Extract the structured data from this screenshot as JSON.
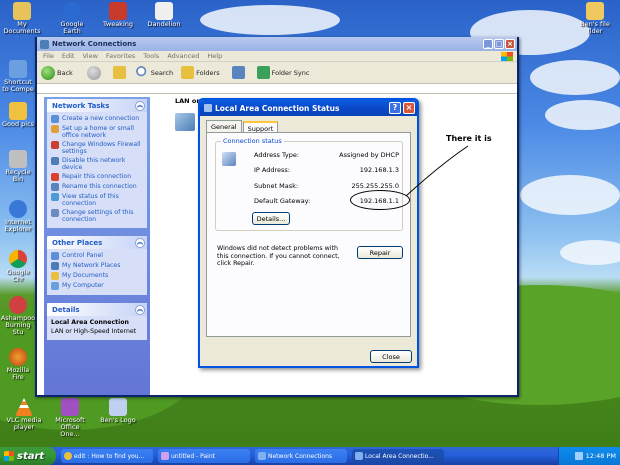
{
  "desktop": {
    "icons": [
      {
        "label": "My Documents",
        "color": "#e8c25a"
      },
      {
        "label": "Google Earth",
        "color": "#2b6ad1"
      },
      {
        "label": "Tweaking",
        "color": "#c83a2a"
      },
      {
        "label": "Dandelion",
        "color": "#f0f0f0"
      },
      {
        "label": "Shortcut to Compe",
        "color": "#6aa0e0"
      },
      {
        "label": "Good pics",
        "color": "#f0c040"
      },
      {
        "label": "Recycle Bin",
        "color": "#bfbfbf"
      },
      {
        "label": "Internet Explorer",
        "color": "#3a78d8"
      },
      {
        "label": "Google Chr",
        "color": "#e0c030"
      },
      {
        "label": "Ashampoo Burning Stu",
        "color": "#d04040"
      },
      {
        "label": "Mozilla Fire",
        "color": "#e07020"
      },
      {
        "label": "VLC media player",
        "color": "#f08020"
      },
      {
        "label": "Microsoft Office One...",
        "color": "#a050c0"
      },
      {
        "label": "Ben's Logo",
        "color": "#c0d0f0"
      },
      {
        "label": "Ben's file flder",
        "color": "#f0c860"
      }
    ]
  },
  "explorer": {
    "title": "Network Connections",
    "menu": [
      "File",
      "Edit",
      "View",
      "Favorites",
      "Tools",
      "Advanced",
      "Help"
    ],
    "toolbar": {
      "back": "Back",
      "search": "Search",
      "folders": "Folders",
      "folder_sync": "Folder Sync"
    },
    "content_header": "LAN or High-Speed Internet",
    "network_tasks": {
      "title": "Network Tasks",
      "items": [
        "Create a new connection",
        "Set up a home or small office network",
        "Change Windows Firewall settings",
        "Disable this network device",
        "Repair this connection",
        "Rename this connection",
        "View status of this connection",
        "Change settings of this connection"
      ]
    },
    "other_places": {
      "title": "Other Places",
      "items": [
        "Control Panel",
        "My Network Places",
        "My Documents",
        "My Computer"
      ]
    },
    "details": {
      "title": "Details",
      "name": "Local Area Connection",
      "type": "LAN or High-Speed Internet"
    }
  },
  "dialog": {
    "title": "Local Area Connection Status",
    "tabs": [
      "General",
      "Support"
    ],
    "active_tab": "Support",
    "group_label": "Connection status",
    "rows": [
      {
        "label": "Address Type:",
        "value": "Assigned by DHCP"
      },
      {
        "label": "IP Address:",
        "value": "192.168.1.3"
      },
      {
        "label": "Subnet Mask:",
        "value": "255.255.255.0"
      },
      {
        "label": "Default Gateway:",
        "value": "192.168.1.1"
      }
    ],
    "details_button": "Details...",
    "repair_note": "Windows did not detect problems with this connection. If you cannot connect, click Repair.",
    "repair_button": "Repair",
    "close_button": "Close"
  },
  "annotation": {
    "text": "There it is"
  },
  "taskbar": {
    "start": "start",
    "tasks": [
      {
        "label": "edit : How to find you...",
        "color": "#e8c040"
      },
      {
        "label": "untitled - Paint",
        "color": "#d0a0f0"
      },
      {
        "label": "Network Connections",
        "color": "#80b0f0"
      },
      {
        "label": "Local Area Connectio...",
        "color": "#80b0f0"
      }
    ],
    "clock": "12:48 PM"
  }
}
